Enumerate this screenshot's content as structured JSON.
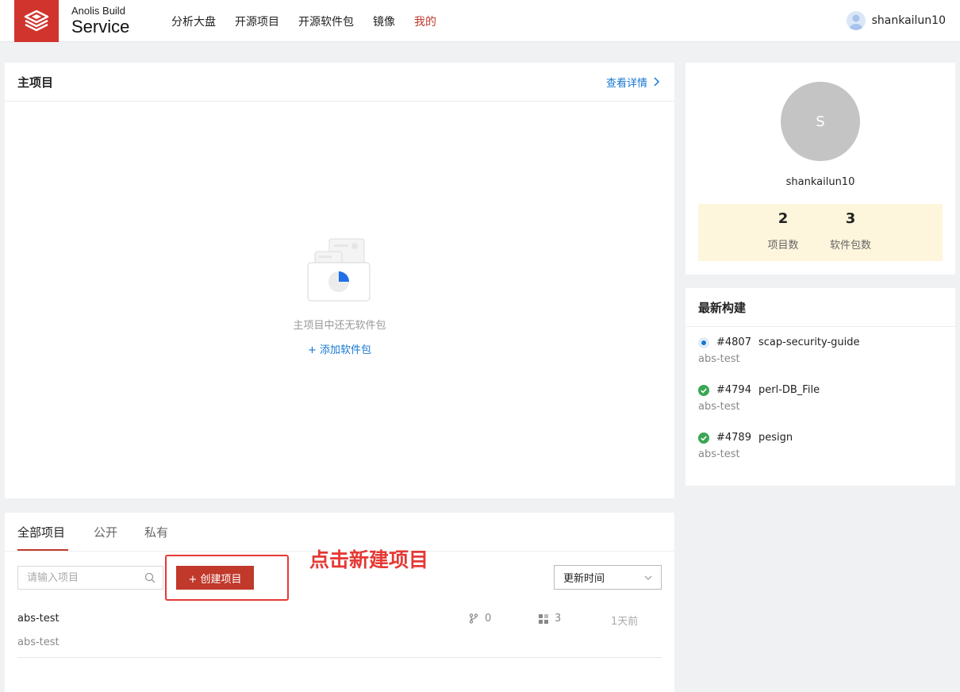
{
  "header": {
    "brand_top": "Anolis Build",
    "brand_bottom": "Service",
    "nav": [
      "分析大盘",
      "开源项目",
      "开源软件包",
      "镜像",
      "我的"
    ],
    "active_nav": "我的",
    "user_name": "shankailun10"
  },
  "main_project": {
    "title": "主项目",
    "detail_link": "查看详情",
    "empty_text": "主项目中还无软件包",
    "add_package": "+ 添加软件包"
  },
  "profile": {
    "avatar_letter": "S",
    "name": "shankailun10",
    "project_count": "2",
    "project_label": "项目数",
    "package_count": "3",
    "package_label": "软件包数"
  },
  "latest_builds": {
    "title": "最新构建",
    "items": [
      {
        "id": "#4807",
        "name": "scap-security-guide",
        "project": "abs-test",
        "status": "running"
      },
      {
        "id": "#4794",
        "name": "perl-DB_File",
        "project": "abs-test",
        "status": "success"
      },
      {
        "id": "#4789",
        "name": "pesign",
        "project": "abs-test",
        "status": "success"
      }
    ]
  },
  "projects": {
    "tabs": [
      "全部项目",
      "公开",
      "私有"
    ],
    "active_tab": "全部项目",
    "search_placeholder": "请输入项目",
    "create_button": "+ 创建项目",
    "sort_value": "更新时间",
    "rows": [
      {
        "name": "abs-test",
        "desc": "abs-test",
        "branches": "0",
        "packages": "3",
        "updated": "1天前"
      }
    ]
  },
  "annotation": "点击新建项目",
  "colors": {
    "brand": "#d0342c",
    "link": "#1677d2",
    "annotation": "#e53935",
    "stats_bg": "#fdf6dc"
  }
}
